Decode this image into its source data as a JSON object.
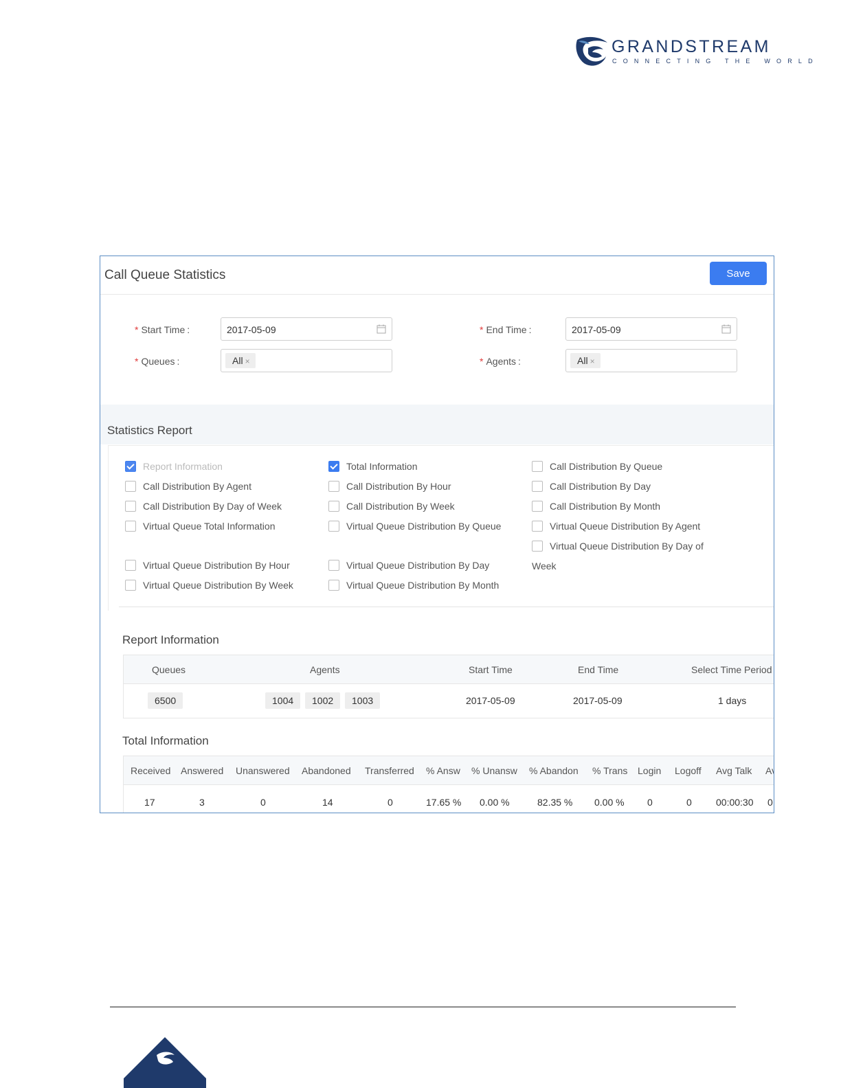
{
  "brand": {
    "name": "GRANDSTREAM",
    "tagline": "CONNECTING THE WORLD",
    "color": "#1f3a6b"
  },
  "window": {
    "title": "Call Queue Statistics",
    "save_label": "Save",
    "accent": "#3b7cf0"
  },
  "form": {
    "start_time_label": "Start Time",
    "start_time_value": "2017-05-09",
    "end_time_label": "End Time",
    "end_time_value": "2017-05-09",
    "queues_label": "Queues",
    "queues_tag": "All",
    "agents_label": "Agents",
    "agents_tag": "All",
    "colon": ":",
    "required_mark": "*"
  },
  "statistics": {
    "title": "Statistics Report",
    "options": [
      {
        "label": "Report Information",
        "checked": true,
        "disabled": true
      },
      {
        "label": "Total Information",
        "checked": true
      },
      {
        "label": "Call Distribution By Queue",
        "checked": false
      },
      {
        "label": "Call Distribution By Agent",
        "checked": false
      },
      {
        "label": "Call Distribution By Hour",
        "checked": false
      },
      {
        "label": "Call Distribution By Day",
        "checked": false
      },
      {
        "label": "Call Distribution By Day of Week",
        "checked": false
      },
      {
        "label": "Call Distribution By Week",
        "checked": false
      },
      {
        "label": "Call Distribution By Month",
        "checked": false
      },
      {
        "label": "Virtual Queue Total Information",
        "checked": false
      },
      {
        "label": "Virtual Queue Distribution By Queue",
        "checked": false
      },
      {
        "label": "Virtual Queue Distribution By Agent",
        "checked": false
      },
      {
        "label": "Virtual Queue Distribution By Day of",
        "checked": false
      },
      {
        "label": "Virtual Queue Distribution By Hour",
        "checked": false
      },
      {
        "label": "Virtual Queue Distribution By Day",
        "checked": false
      },
      {
        "label": "Virtual Queue Distribution By Week",
        "checked": false
      },
      {
        "label": "Virtual Queue Distribution By Month",
        "checked": false
      }
    ],
    "wrap_text": "Week"
  },
  "report_info": {
    "title": "Report Information",
    "headers": [
      "Queues",
      "Agents",
      "Start Time",
      "End Time",
      "Select Time Period"
    ],
    "queue": "6500",
    "agents": [
      "1004",
      "1002",
      "1003"
    ],
    "start_time": "2017-05-09",
    "end_time": "2017-05-09",
    "period": "1 days"
  },
  "total_info": {
    "title": "Total Information",
    "headers": [
      "Received",
      "Answered",
      "Unanswered",
      "Abandoned",
      "Transferred",
      "% Answ",
      "% Unansw",
      "% Abandon",
      "% Trans",
      "Login",
      "Logoff",
      "Avg Talk",
      "Av"
    ],
    "values": [
      "17",
      "3",
      "0",
      "14",
      "0",
      "17.65 %",
      "0.00 %",
      "82.35 %",
      "0.00 %",
      "0",
      "0",
      "00:00:30",
      "0"
    ]
  }
}
